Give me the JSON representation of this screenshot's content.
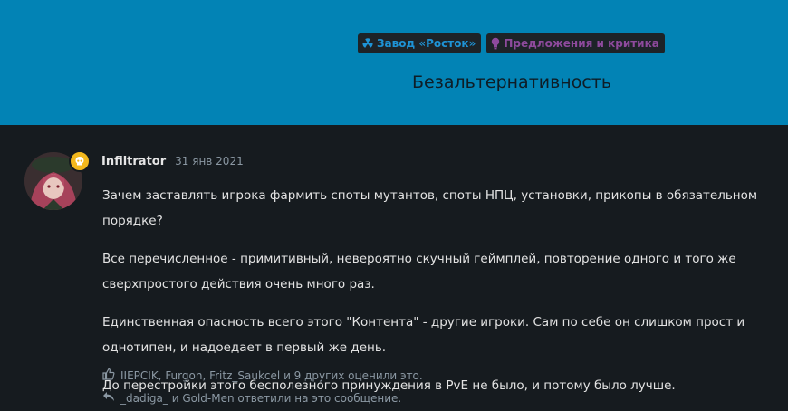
{
  "header": {
    "tags": [
      {
        "label": "Завод «Росток»",
        "icon": "radiation-icon",
        "color": "#1e93d6"
      },
      {
        "label": "Предложения и критика",
        "icon": "lightbulb-icon",
        "color": "#8e4a9d"
      }
    ],
    "title": "Безальтернативность",
    "background": "#0283b5"
  },
  "post": {
    "username": "Infiltrator",
    "date": "31 янв 2021",
    "badge_icon": "skull-icon",
    "paragraphs": [
      "Зачем заставлять игрока фармить споты мутантов, споты НПЦ, установки, прикопы в обязательном порядке?",
      "Все перечисленное - примитивный, невероятно скучный геймплей, повторение одного и того же сверхпростого действия очень много раз.",
      "Единственная опасность всего этого \"Контента\" - другие игроки. Сам по себе он слишком прост и однотипен, и надоедает в первый же день.",
      "До перестройки этого бесполезного принуждения в PvE не было, и потому было лучше."
    ],
    "likes": {
      "users": "IIEPCIK, Furgon, Fritz_Saukcel",
      "text": "и 9 других оценили это."
    },
    "replies": {
      "text": "_dadiga_ и Gold-Men ответили на это сообщение."
    }
  }
}
